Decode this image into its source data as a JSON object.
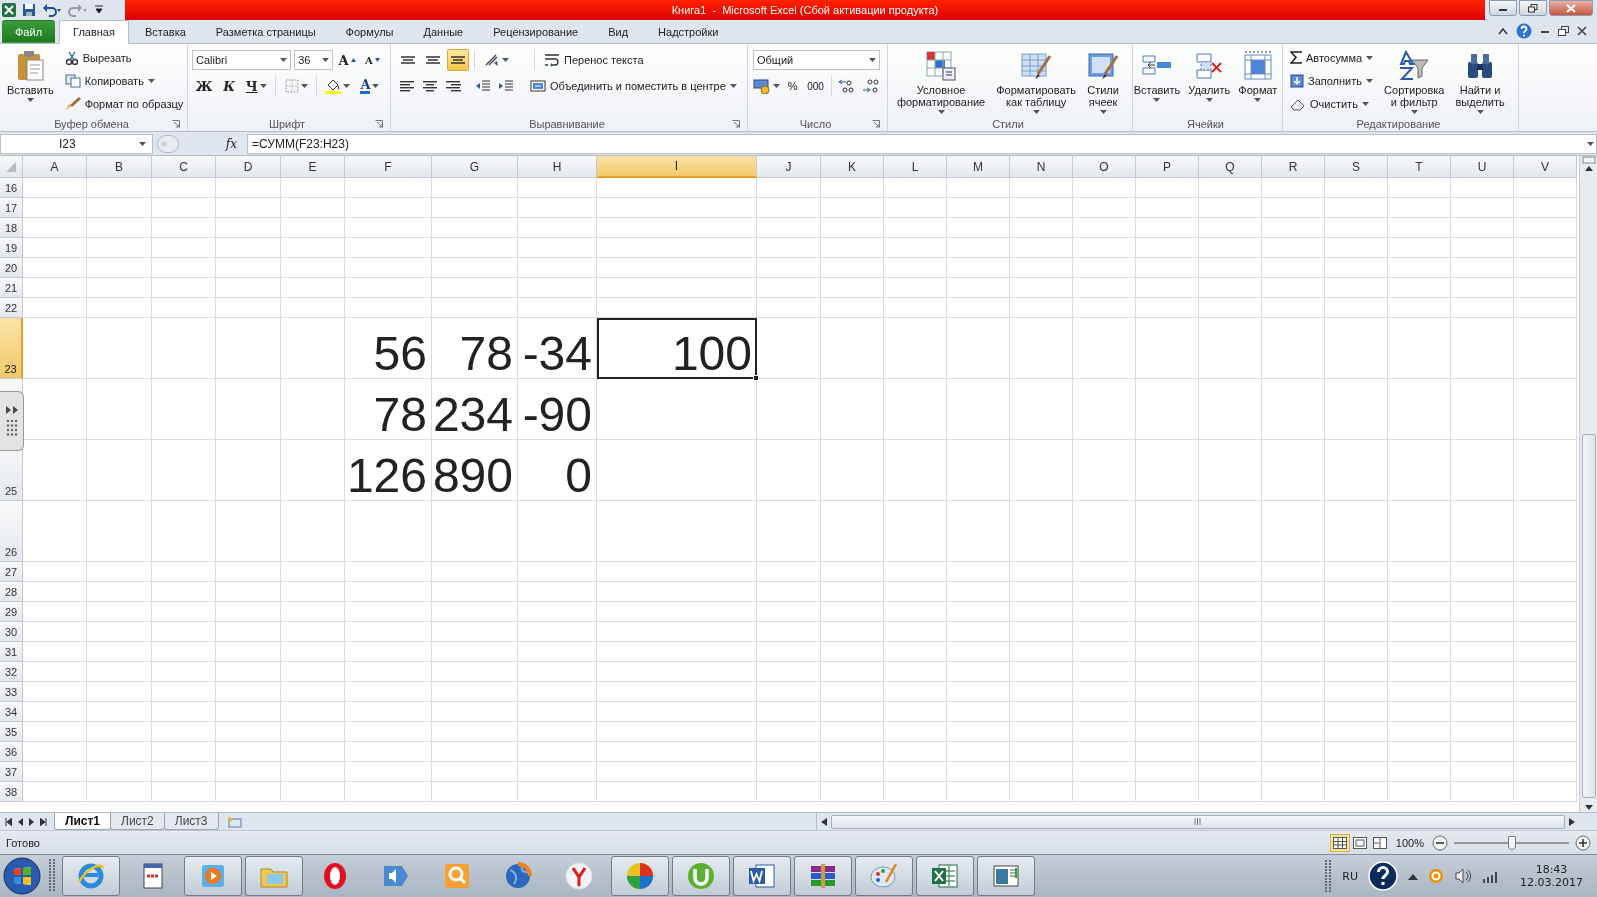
{
  "title_bar": {
    "title": "Книга1  -  Microsoft Excel (Сбой активации продукта)"
  },
  "ribbon_tabs": [
    {
      "label": "Файл",
      "kind": "file",
      "selected": false
    },
    {
      "label": "Главная",
      "kind": "tab",
      "selected": true
    },
    {
      "label": "Вставка",
      "kind": "tab",
      "selected": false
    },
    {
      "label": "Разметка страницы",
      "kind": "tab",
      "selected": false
    },
    {
      "label": "Формулы",
      "kind": "tab",
      "selected": false
    },
    {
      "label": "Данные",
      "kind": "tab",
      "selected": false
    },
    {
      "label": "Рецензирование",
      "kind": "tab",
      "selected": false
    },
    {
      "label": "Вид",
      "kind": "tab",
      "selected": false
    },
    {
      "label": "Надстройки",
      "kind": "tab",
      "selected": false
    }
  ],
  "ribbon": {
    "clipboard": {
      "paste": "Вставить",
      "cut": "Вырезать",
      "copy": "Копировать",
      "format_painter": "Формат по образцу",
      "group": "Буфер обмена"
    },
    "font": {
      "name": "Calibri",
      "size": "36",
      "grow": "A",
      "shrink": "A",
      "bold": "Ж",
      "italic": "К",
      "underline": "Ч",
      "font_color": "A",
      "group": "Шрифт"
    },
    "alignment": {
      "vertical": [
        {
          "selected": false
        },
        {
          "selected": false
        },
        {
          "selected": true
        }
      ],
      "wrap": "Перенос текста",
      "merge": "Объединить и поместить в центре",
      "group": "Выравнивание"
    },
    "number": {
      "format": "Общий",
      "percent": "%",
      "thousands": "000",
      "group": "Число"
    },
    "styles": {
      "buttons": [
        {
          "lines": [
            "Условное",
            "форматирование"
          ]
        },
        {
          "lines": [
            "Форматировать",
            "как таблицу"
          ]
        },
        {
          "lines": [
            "Стили",
            "ячеек"
          ]
        }
      ],
      "group": "Стили"
    },
    "cells": {
      "buttons": [
        "Вставить",
        "Удалить",
        "Формат"
      ],
      "group": "Ячейки"
    },
    "editing": {
      "autosum": "Автосумма",
      "fill": "Заполнить",
      "clear": "Очистить",
      "sort": [
        "Сортировка",
        "и фильтр"
      ],
      "find": [
        "Найти и",
        "выделить"
      ],
      "group": "Редактирование"
    }
  },
  "formula_bar": {
    "name_box": "I23",
    "function_label": "fx",
    "formula": "=СУММ(F23:H23)"
  },
  "sheet": {
    "columns": [
      {
        "label": "A",
        "selected": false
      },
      {
        "label": "B",
        "selected": false
      },
      {
        "label": "C",
        "selected": false
      },
      {
        "label": "D",
        "selected": false
      },
      {
        "label": "E",
        "selected": false
      },
      {
        "label": "F",
        "selected": false
      },
      {
        "label": "G",
        "selected": false
      },
      {
        "label": "H",
        "selected": false
      },
      {
        "label": "I",
        "selected": true
      },
      {
        "label": "J",
        "selected": false
      },
      {
        "label": "K",
        "selected": false
      },
      {
        "label": "L",
        "selected": false
      },
      {
        "label": "M",
        "selected": false
      },
      {
        "label": "N",
        "selected": false
      },
      {
        "label": "O",
        "selected": false
      },
      {
        "label": "P",
        "selected": false
      },
      {
        "label": "Q",
        "selected": false
      },
      {
        "label": "R",
        "selected": false
      },
      {
        "label": "S",
        "selected": false
      },
      {
        "label": "T",
        "selected": false
      },
      {
        "label": "U",
        "selected": false
      },
      {
        "label": "V",
        "selected": false
      }
    ],
    "rows": [
      {
        "label": "16",
        "selected": false,
        "cells": {}
      },
      {
        "label": "17",
        "selected": false,
        "cells": {}
      },
      {
        "label": "18",
        "selected": false,
        "cells": {}
      },
      {
        "label": "19",
        "selected": false,
        "cells": {}
      },
      {
        "label": "20",
        "selected": false,
        "cells": {}
      },
      {
        "label": "21",
        "selected": false,
        "cells": {}
      },
      {
        "label": "22",
        "selected": false,
        "cells": {}
      },
      {
        "label": "23",
        "selected": true,
        "cells": {
          "F": "56",
          "G": "78",
          "H": "-34",
          "I": "100"
        }
      },
      {
        "selected": false,
        "cells": {
          "F": "78",
          "G": "234",
          "H": "-90"
        }
      },
      {
        "label": "25",
        "selected": false,
        "cells": {
          "F": "126",
          "G": "890",
          "H": "0"
        }
      },
      {
        "label": "26",
        "selected": false,
        "cells": {}
      },
      {
        "label": "27",
        "selected": false,
        "cells": {}
      },
      {
        "label": "28",
        "selected": false,
        "cells": {}
      },
      {
        "label": "29",
        "selected": false,
        "cells": {}
      },
      {
        "label": "30",
        "selected": false,
        "cells": {}
      },
      {
        "label": "31",
        "selected": false,
        "cells": {}
      },
      {
        "label": "32",
        "selected": false,
        "cells": {}
      },
      {
        "label": "33",
        "selected": false,
        "cells": {}
      },
      {
        "label": "34",
        "selected": false,
        "cells": {}
      },
      {
        "label": "35",
        "selected": false,
        "cells": {}
      },
      {
        "label": "36",
        "selected": false,
        "cells": {}
      },
      {
        "label": "37",
        "selected": false,
        "cells": {}
      },
      {
        "label": "38",
        "selected": false,
        "cells": {}
      }
    ]
  },
  "sheet_tabs": [
    {
      "label": "Лист1",
      "selected": true
    },
    {
      "label": "Лист2",
      "selected": false
    },
    {
      "label": "Лист3",
      "selected": false
    }
  ],
  "status_bar": {
    "status": "Готово",
    "views": [
      {
        "selected": true
      },
      {
        "selected": false
      },
      {
        "selected": false
      }
    ],
    "zoom": "100%",
    "zoom_slider": {
      "level": 0.5
    }
  },
  "taskbar": {
    "apps": [
      {
        "open": true
      },
      {
        "open": false
      },
      {
        "open": true
      },
      {
        "open": true
      },
      {
        "open": false
      },
      {
        "open": false
      },
      {
        "open": false
      },
      {
        "open": false
      },
      {
        "open": false
      },
      {
        "open": true
      },
      {
        "open": true
      },
      {
        "open": true
      },
      {
        "open": true
      },
      {
        "open": true
      },
      {
        "open": true
      },
      {
        "open": true
      }
    ],
    "language": "RU",
    "time": "18:43",
    "date": "12.03.2017"
  }
}
